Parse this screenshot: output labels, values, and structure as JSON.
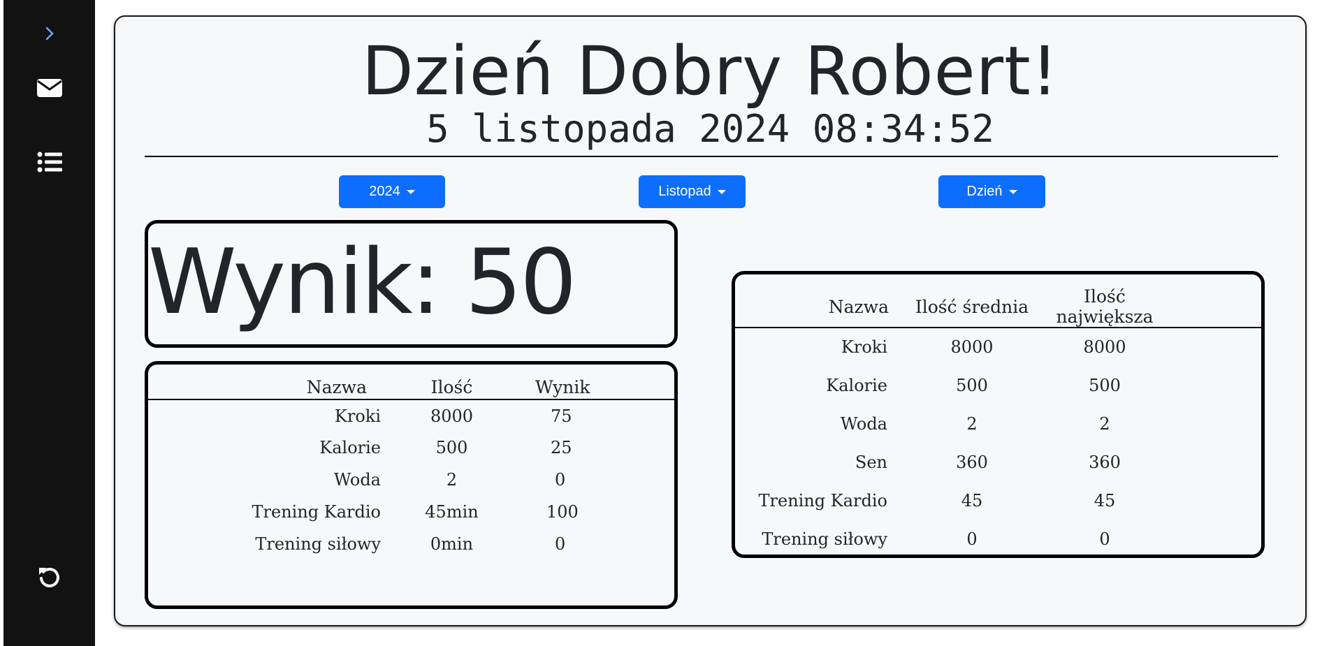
{
  "sidebar": {
    "toggle_icon": "chevron-right-icon",
    "mail_icon": "envelope-icon",
    "list_icon": "list-icon",
    "reset_icon": "rotate-left-icon"
  },
  "header": {
    "greeting": "Dzień Dobry Robert!",
    "datetime": "5 listopada 2024 08:34:52"
  },
  "filters": {
    "year": "2024",
    "month": "Listopad",
    "period": "Dzień"
  },
  "score": {
    "text": "Wynik: 50"
  },
  "daily_table": {
    "headers": [
      "Nazwa",
      "Ilość",
      "Wynik"
    ],
    "rows": [
      [
        "Kroki",
        "8000",
        "75"
      ],
      [
        "Kalorie",
        "500",
        "25"
      ],
      [
        "Woda",
        "2",
        "0"
      ],
      [
        "Trening Kardio",
        "45min",
        "100"
      ],
      [
        "Trening siłowy",
        "0min",
        "0"
      ]
    ]
  },
  "summary_table": {
    "headers": [
      "Nazwa",
      "Ilość średnia",
      "Ilość największa"
    ],
    "rows": [
      [
        "Kroki",
        "8000",
        "8000"
      ],
      [
        "Kalorie",
        "500",
        "500"
      ],
      [
        "Woda",
        "2",
        "2"
      ],
      [
        "Sen",
        "360",
        "360"
      ],
      [
        "Trening Kardio",
        "45",
        "45"
      ],
      [
        "Trening siłowy",
        "0",
        "0"
      ]
    ]
  },
  "colors": {
    "sidebar": "#121212",
    "accent": "#0d6efd",
    "toggle": "#6ea8fe",
    "card": "#f7f8fa"
  }
}
